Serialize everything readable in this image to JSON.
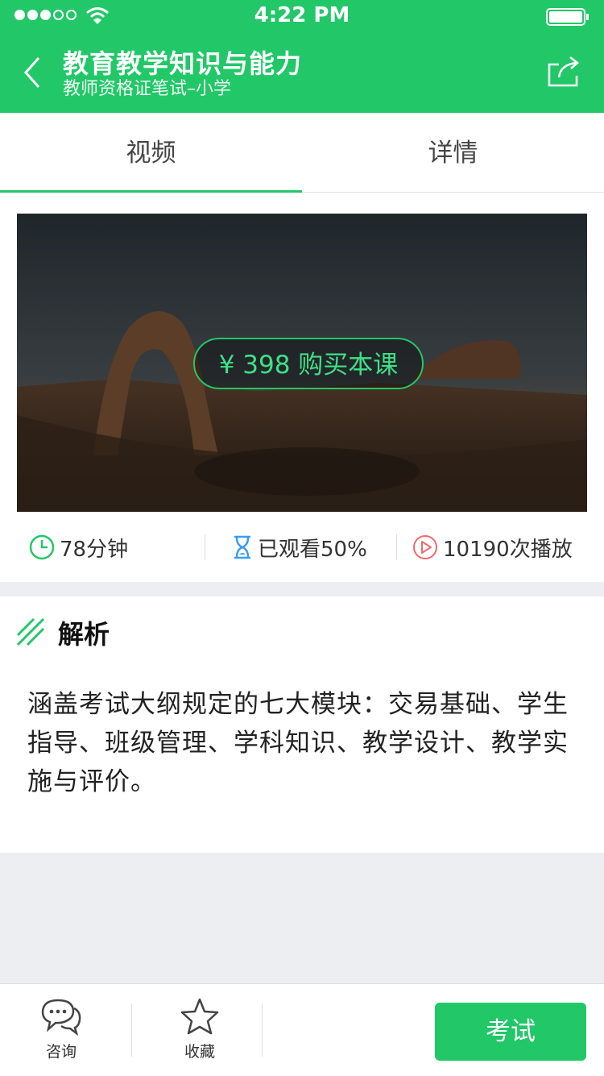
{
  "status": {
    "time": "4:22 PM",
    "signal_bars": 3,
    "signal_total": 5
  },
  "header": {
    "title": "教育教学知识与能力",
    "subtitle": "教师资格证笔试–小学"
  },
  "tabs": [
    {
      "label": "视频",
      "active": true
    },
    {
      "label": "详情",
      "active": false
    }
  ],
  "video": {
    "buy_label": "¥ 398 购买本课"
  },
  "stats": {
    "duration": "78分钟",
    "progress": "已观看50%",
    "plays": "10190次播放"
  },
  "analysis": {
    "title": "解析",
    "body": "涵盖考试大纲规定的七大模块：交易基础、学生指导、班级管理、学科知识、教学设计、教学实施与评价。"
  },
  "bottom": {
    "consult_label": "咨询",
    "favorite_label": "收藏",
    "exam_label": "考试"
  },
  "colors": {
    "accent": "#22c768",
    "play_icon": "#f06a6a",
    "hourglass_icon": "#3a9df0",
    "page_bg": "#eceef1"
  },
  "icons": [
    "back-arrow-icon",
    "share-icon",
    "clock-icon",
    "hourglass-icon",
    "play-circle-icon",
    "slash-lines-icon",
    "chat-bubbles-icon",
    "star-icon",
    "wifi-icon",
    "battery-icon"
  ]
}
